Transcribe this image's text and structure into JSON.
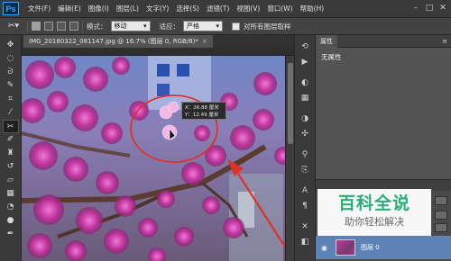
{
  "app": {
    "logo": "Ps"
  },
  "menu": [
    "文件(F)",
    "编辑(E)",
    "图像(I)",
    "图层(L)",
    "文字(Y)",
    "选择(S)",
    "滤镜(T)",
    "视图(V)",
    "窗口(W)",
    "帮助(H)"
  ],
  "window_controls": {
    "minimize": "–",
    "maximize": "□",
    "close": "✕"
  },
  "options": {
    "tool_glyph": "✂▾",
    "mode_label": "模式：",
    "mode_value": "移动",
    "adapt_label": "适应：",
    "adapt_value": "严格",
    "sample_all_label": "对所有图层取样"
  },
  "document": {
    "tab_title": "IMG_20180322_081147.jpg @ 16.7% (图层 0, RGB/8)*",
    "close": "×"
  },
  "tooltip": {
    "line1": "X：26.88 厘米",
    "line2": "Y：12.49 厘米"
  },
  "properties": {
    "tab": "属性",
    "content": "无属性",
    "menu": "≡"
  },
  "layers": {
    "layer_name": "图层 0"
  },
  "watermark": {
    "title": "百科全说",
    "subtitle": "助你轻松解决"
  },
  "colors": {
    "accent": "#31a8ff",
    "annotation": "#e0302a",
    "layer_selected": "#5d83b6",
    "watermark_green": "#2ab27b"
  },
  "icons": {
    "toolbar": [
      "move-icon",
      "marquee-icon",
      "lasso-icon",
      "quick-select-icon",
      "crop-icon",
      "eyedropper-icon",
      "content-aware-move-icon",
      "brush-icon",
      "stamp-icon",
      "history-brush-icon",
      "eraser-icon",
      "gradient-icon",
      "blur-icon",
      "dodge-icon",
      "pen-icon"
    ]
  }
}
